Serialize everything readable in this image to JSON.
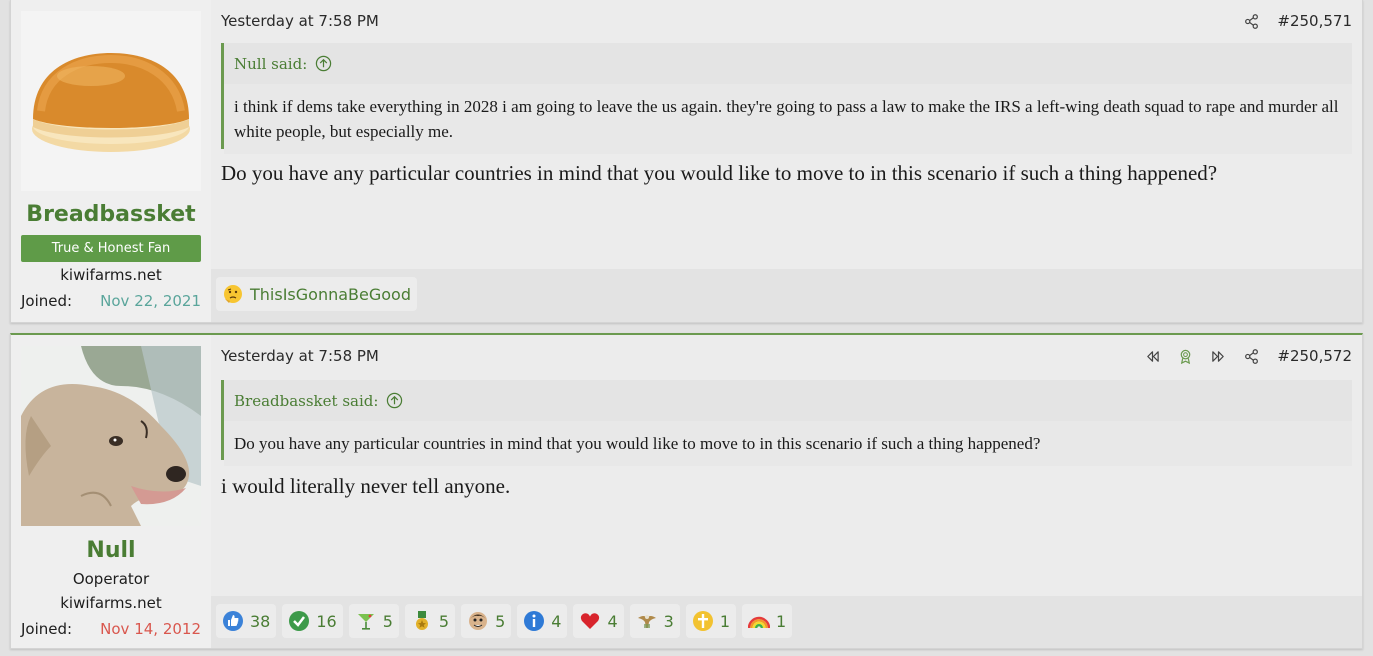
{
  "posts": [
    {
      "username": "Breadbassket",
      "user_title": "True & Honest Fan",
      "site": "kiwifarms.net",
      "joined_label": "Joined:",
      "joined_date": "Nov 22, 2021",
      "date": "Yesterday at 7:58 PM",
      "post_number": "#250,571",
      "quote_author": "Null said:",
      "quote_text": "i think if dems take everything in 2028 i am going to leave the us again. they're going to pass a law to make the IRS a left-wing death squad to rape and murder all white people, but especially me.",
      "message": "Do you have any particular countries in mind that you would like to move to in this scenario if such a thing happened?",
      "reactions": [
        {
          "icon": "thinking-face-icon",
          "label": "ThisIsGonnaBeGood"
        }
      ]
    },
    {
      "username": "Null",
      "user_role": "Ooperator",
      "site": "kiwifarms.net",
      "joined_label": "Joined:",
      "joined_date": "Nov 14, 2012",
      "date": "Yesterday at 7:58 PM",
      "post_number": "#250,572",
      "quote_author": "Breadbassket said:",
      "quote_text": "Do you have any particular countries in mind that you would like to move to in this scenario if such a thing happened?",
      "message": "i would literally never tell anyone.",
      "reactions": [
        {
          "icon": "thumbs-up-icon",
          "count": "38"
        },
        {
          "icon": "check-icon",
          "count": "16"
        },
        {
          "icon": "cocktail-icon",
          "count": "5"
        },
        {
          "icon": "medal-icon",
          "count": "5"
        },
        {
          "icon": "face-icon",
          "count": "5"
        },
        {
          "icon": "info-icon",
          "count": "4"
        },
        {
          "icon": "heart-icon",
          "count": "4"
        },
        {
          "icon": "eagle-icon",
          "count": "3"
        },
        {
          "icon": "cross-icon",
          "count": "1"
        },
        {
          "icon": "rainbow-icon",
          "count": "1"
        }
      ]
    }
  ],
  "colors": {
    "accent_green": "#4a7d34",
    "title_badge": "#5f9b48",
    "quote_border": "#6b9a4f"
  }
}
